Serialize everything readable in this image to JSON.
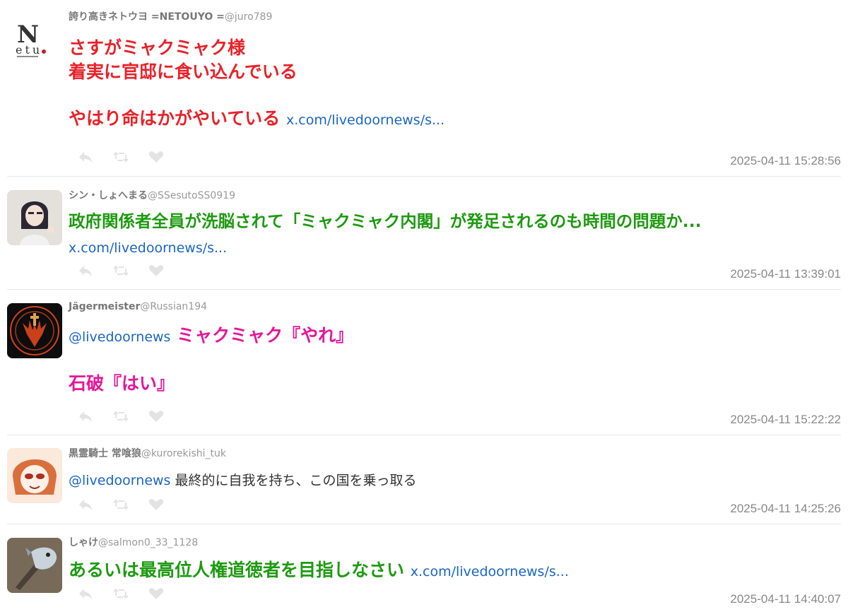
{
  "tweets": [
    {
      "name": "誇り高きネトウヨ =NETOUYO =",
      "handle": "@juro789",
      "lines": [
        "さすがミャクミャク様",
        "着実に官邸に食い込んでいる",
        "",
        "やはり命はかがやいている"
      ],
      "link": "x.com/livedoornews/s...",
      "time": "2025-04-11 15:28:56",
      "color": "#e8222a"
    },
    {
      "name": "シン・しょへまる",
      "handle": "@SSesutoSS0919",
      "lines": [
        "政府関係者全員が洗脳されて「ミャクミャク内閣」が発足されるのも時間の問題か..."
      ],
      "link": "x.com/livedoornews/s...",
      "time": "2025-04-11 13:39:01",
      "color": "#1e9a11"
    },
    {
      "name": "Jägermeister",
      "handle": "@Russian194",
      "mention": "@livedoornews",
      "lines": [
        "ミャクミャク『やれ』",
        "",
        "石破『はい』"
      ],
      "time": "2025-04-11 15:22:22",
      "color": "#e6169a"
    },
    {
      "name": "黒霊騎士 常喰狼",
      "handle": "@kurorekishi_tuk",
      "mention": "@livedoornews",
      "lines": [
        "最終的に自我を持ち、この国を乗っ取る"
      ],
      "time": "2025-04-11 14:25:26"
    },
    {
      "name": "しゃけ",
      "handle": "@salmon0_33_1128",
      "lines": [
        "あるいは最高位人権道徳者を目指しなさい"
      ],
      "link": "x.com/livedoornews/s...",
      "time": "2025-04-11 14:40:07",
      "color": "#1e9a11"
    }
  ],
  "avatar_logo": {
    "big": "N",
    "small": "etu"
  }
}
